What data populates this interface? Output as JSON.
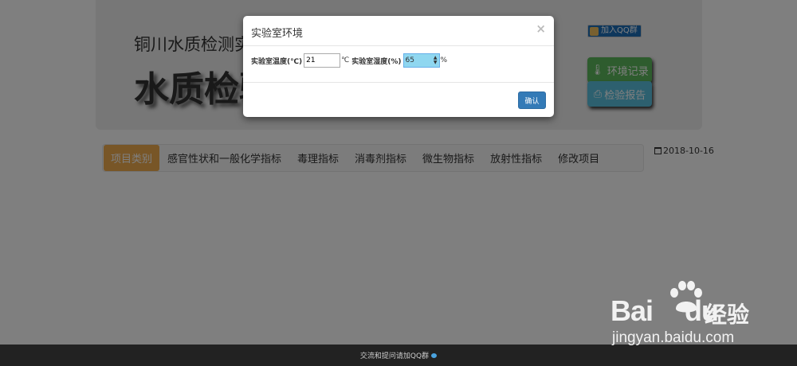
{
  "header": {
    "subtitle": "铜川水质检测实",
    "title": "水质检验",
    "qq_join": "加入QQ群",
    "env_record": "环境记录",
    "inspect_report": "检验报告"
  },
  "nav": {
    "brand": "项目类别",
    "items": [
      "感官性状和一般化学指标",
      "毒理指标",
      "消毒剂指标",
      "微生物指标",
      "放射性指标",
      "修改项目"
    ]
  },
  "date": "2018-10-16",
  "footer": {
    "text": "交流和提问请加QQ群"
  },
  "watermark": {
    "brand": "Bai",
    "brand2": "du",
    "cn": "经验",
    "url": "jingyan.baidu.com"
  },
  "modal": {
    "title": "实验室环境",
    "close": "×",
    "temp_label": "实验室温度(℃)",
    "temp_value": "21",
    "temp_unit": "℃",
    "humidity_label": "实验室湿度(%)",
    "humidity_value": "65",
    "humidity_unit": "%",
    "confirm": "确认"
  },
  "colors": {
    "overlay": "#000000",
    "primary": "#337ab7",
    "success": "#5cb85c",
    "info": "#5bc0de",
    "warning": "#f0ad4e"
  }
}
